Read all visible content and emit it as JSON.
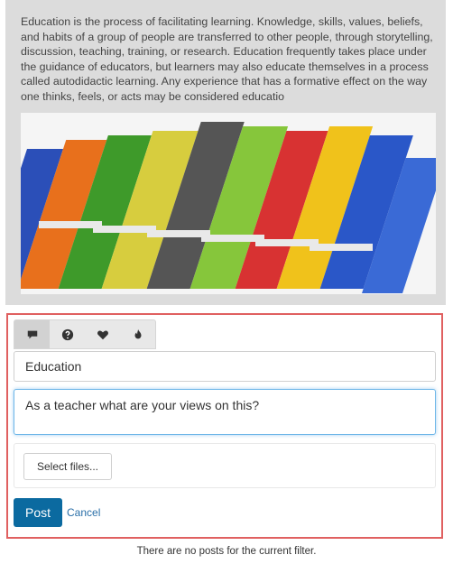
{
  "post": {
    "text": "Education is the process of facilitating learning. Knowledge, skills, values, beliefs, and habits of a group of people are transferred to other people, through storytelling, discussion, teaching, training, or research. Education frequently takes place under the guidance of educators, but learners may also educate themselves in a process called autodidactic learning. Any experience that has a formative effect on the way one thinks, feels, or acts may be considered educatio"
  },
  "composer": {
    "tabs": [
      {
        "icon": "comment-icon",
        "active": true
      },
      {
        "icon": "question-icon",
        "active": false
      },
      {
        "icon": "heart-icon",
        "active": false
      },
      {
        "icon": "flame-icon",
        "active": false
      }
    ],
    "title_value": "Education",
    "body_value": "As a teacher what are your views on this?",
    "files_button": "Select files...",
    "post_button": "Post",
    "cancel_link": "Cancel"
  },
  "status": {
    "no_posts": "There are no posts for the current filter."
  },
  "colors": {
    "composer_border": "#e06060",
    "post_button": "#0b6aa0",
    "link": "#2a6fa8",
    "card_bg": "#dcdcdc"
  }
}
